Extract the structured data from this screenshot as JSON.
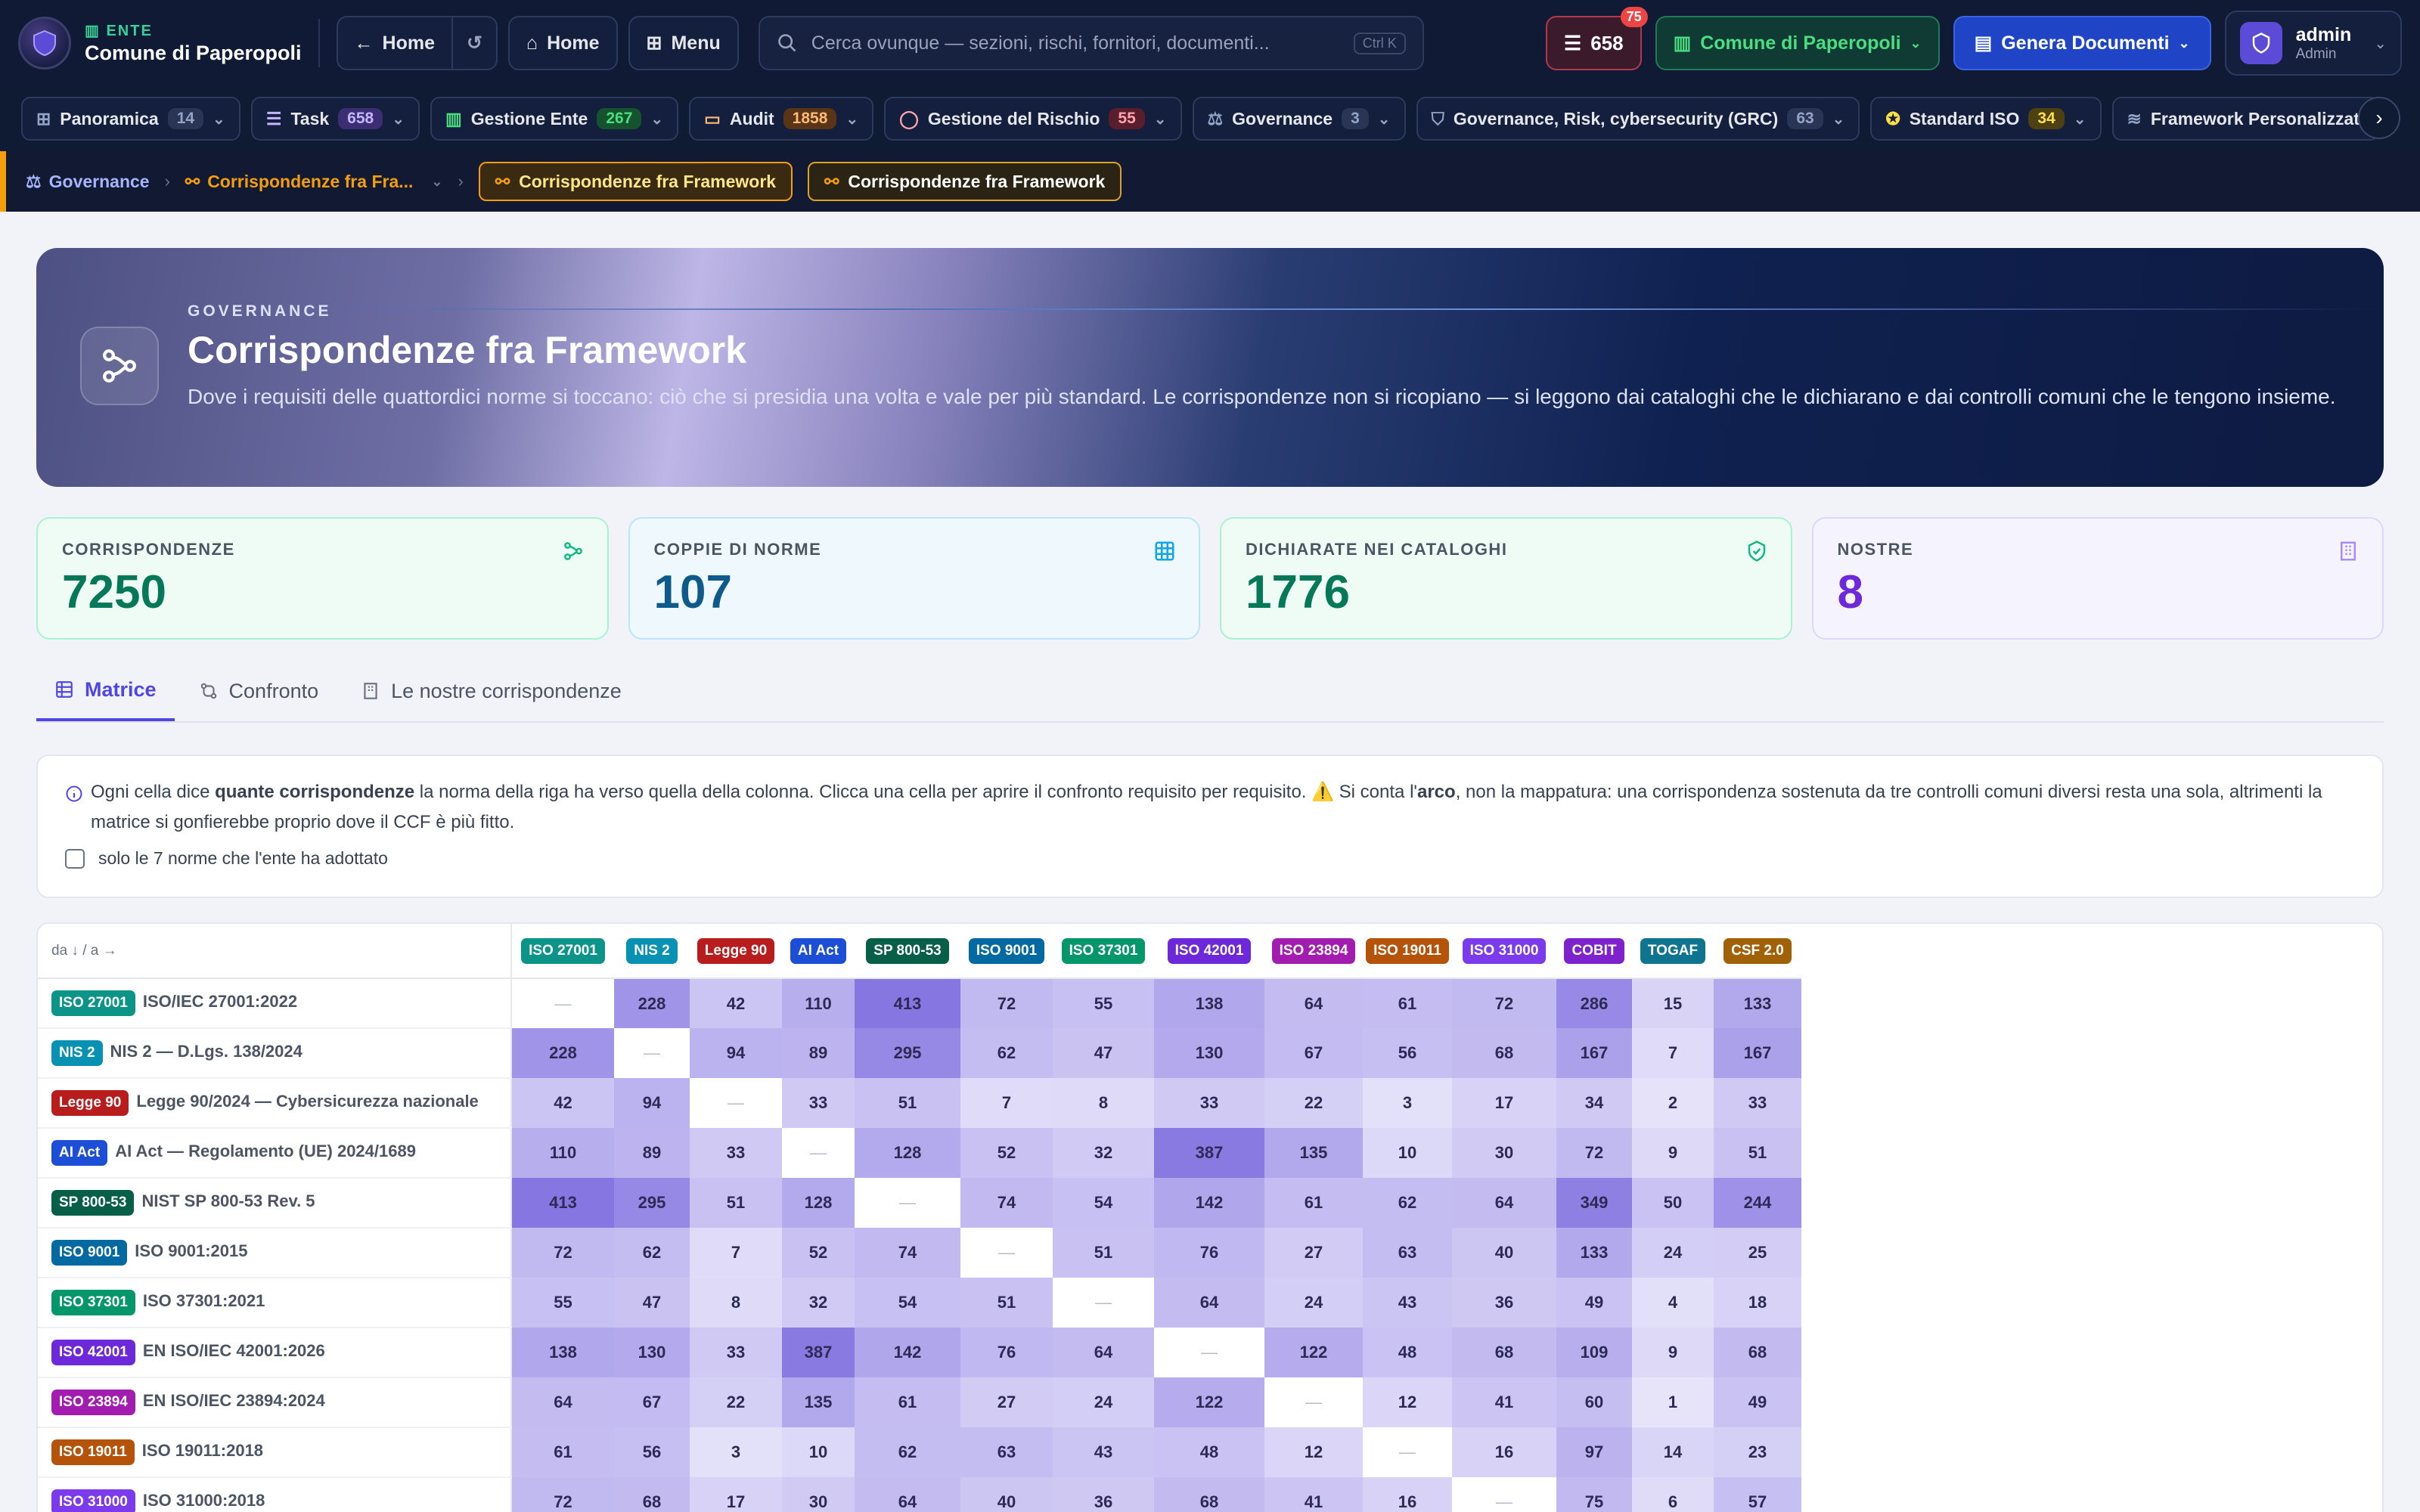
{
  "header": {
    "ente_label": "ENTE",
    "ente_name": "Comune di Paperopoli",
    "home_back_label": "Home",
    "home_label": "Home",
    "menu_label": "Menu",
    "search_placeholder": "Cerca ovunque — sezioni, rischi, fornitori, documenti...",
    "search_shortcut": "Ctrl K",
    "task_count": "658",
    "task_badge": "75",
    "ente_selector": "Comune di Paperopoli",
    "generate_label": "Genera Documenti",
    "user_name": "admin",
    "user_role": "Admin"
  },
  "modules": [
    {
      "label": "Panoramica",
      "count": "14",
      "color": "#93a4c8",
      "bg": "#2a3556"
    },
    {
      "label": "Task",
      "count": "658",
      "color": "#c4b5fd",
      "bg": "#3b2e73"
    },
    {
      "label": "Gestione Ente",
      "count": "267",
      "color": "#4ade80",
      "bg": "#14532d"
    },
    {
      "label": "Audit",
      "count": "1858",
      "color": "#fdba74",
      "bg": "#5a3416"
    },
    {
      "label": "Gestione del Rischio",
      "count": "55",
      "color": "#fda4af",
      "bg": "#5a1d2b"
    },
    {
      "label": "Governance",
      "count": "3",
      "color": "#93a4c8",
      "bg": "#2a3556"
    },
    {
      "label": "Governance, Risk, cybersecurity (GRC)",
      "count": "63",
      "color": "#93a4c8",
      "bg": "#2a3556"
    },
    {
      "label": "Standard ISO",
      "count": "34",
      "color": "#fde047",
      "bg": "#4d4012"
    },
    {
      "label": "Framework Personalizzati",
      "count": "",
      "color": "#93a4c8",
      "bg": "#2a3556"
    }
  ],
  "breadcrumb": {
    "item1": "Governance",
    "item2": "Corrispondenze fra Fra...",
    "chip1": "Corrispondenze fra Framework",
    "chip2": "Corrispondenze fra Framework"
  },
  "hero": {
    "kicker": "GOVERNANCE",
    "title": "Corrispondenze fra Framework",
    "subtitle": "Dove i requisiti delle quattordici norme si toccano: ciò che si presidia una volta e vale per più standard. Le corrispondenze non si ricopiano — si leggono dai cataloghi che le dichiarano e dai controlli comuni che le tengono insieme."
  },
  "stats": [
    {
      "label": "CORRISPONDENZE",
      "value": "7250"
    },
    {
      "label": "COPPIE DI NORME",
      "value": "107"
    },
    {
      "label": "DICHIARATE NEI CATALOGHI",
      "value": "1776"
    },
    {
      "label": "NOSTRE",
      "value": "8"
    }
  ],
  "tabs": [
    {
      "label": "Matrice"
    },
    {
      "label": "Confronto"
    },
    {
      "label": "Le nostre corrispondenze"
    }
  ],
  "info": {
    "t1": "Ogni cella dice ",
    "t2": "quante corrispondenze",
    "t3": " la norma della riga ha verso quella della colonna. Clicca una cella per aprire il confronto requisito per requisito. ⚠️ Si conta l'",
    "t4": "arco",
    "t5": ", non la mappatura: una corrispondenza sostenuta da tre controlli comuni diversi resta una sola, altrimenti la matrice si gonfierebbe proprio dove il CCF è più fitto.",
    "checkbox_label": "solo le 7 norme che l'ente ha adottato"
  },
  "matrix": {
    "corner": "da ↓ / a →",
    "columns": [
      {
        "code": "ISO 27001",
        "color": "#0d9488"
      },
      {
        "code": "NIS 2",
        "color": "#0891b2"
      },
      {
        "code": "Legge 90",
        "color": "#b91c1c"
      },
      {
        "code": "AI Act",
        "color": "#1d4ed8"
      },
      {
        "code": "SP 800-53",
        "color": "#065f46"
      },
      {
        "code": "ISO 9001",
        "color": "#0369a1"
      },
      {
        "code": "ISO 37301",
        "color": "#059669"
      },
      {
        "code": "ISO 42001",
        "color": "#6d28d9"
      },
      {
        "code": "ISO 23894",
        "color": "#a21caf"
      },
      {
        "code": "ISO 19011",
        "color": "#b45309"
      },
      {
        "code": "ISO 31000",
        "color": "#7c3aed"
      },
      {
        "code": "COBIT",
        "color": "#7e22ce"
      },
      {
        "code": "TOGAF",
        "color": "#0e7490"
      },
      {
        "code": "CSF 2.0",
        "color": "#a16207"
      }
    ],
    "rows": [
      {
        "code": "ISO 27001",
        "name": "ISO/IEC 27001:2022",
        "color": "#0d9488",
        "values": [
          null,
          228,
          42,
          110,
          413,
          72,
          55,
          138,
          64,
          61,
          72,
          286,
          15,
          133
        ]
      },
      {
        "code": "NIS 2",
        "name": "NIS 2 — D.Lgs. 138/2024",
        "color": "#0891b2",
        "values": [
          228,
          null,
          94,
          89,
          295,
          62,
          47,
          130,
          67,
          56,
          68,
          167,
          7,
          167
        ]
      },
      {
        "code": "Legge 90",
        "name": "Legge 90/2024 — Cybersicurezza nazionale",
        "color": "#b91c1c",
        "values": [
          42,
          94,
          null,
          33,
          51,
          7,
          8,
          33,
          22,
          3,
          17,
          34,
          2,
          33
        ]
      },
      {
        "code": "AI Act",
        "name": "AI Act — Regolamento (UE) 2024/1689",
        "color": "#1d4ed8",
        "values": [
          110,
          89,
          33,
          null,
          128,
          52,
          32,
          387,
          135,
          10,
          30,
          72,
          9,
          51
        ]
      },
      {
        "code": "SP 800-53",
        "name": "NIST SP 800-53 Rev. 5",
        "color": "#065f46",
        "values": [
          413,
          295,
          51,
          128,
          null,
          74,
          54,
          142,
          61,
          62,
          64,
          349,
          50,
          244
        ]
      },
      {
        "code": "ISO 9001",
        "name": "ISO 9001:2015",
        "color": "#0369a1",
        "values": [
          72,
          62,
          7,
          52,
          74,
          null,
          51,
          76,
          27,
          63,
          40,
          133,
          24,
          25
        ]
      },
      {
        "code": "ISO 37301",
        "name": "ISO 37301:2021",
        "color": "#059669",
        "values": [
          55,
          47,
          8,
          32,
          54,
          51,
          null,
          64,
          24,
          43,
          36,
          49,
          4,
          18
        ]
      },
      {
        "code": "ISO 42001",
        "name": "EN ISO/IEC 42001:2026",
        "color": "#6d28d9",
        "values": [
          138,
          130,
          33,
          387,
          142,
          76,
          64,
          null,
          122,
          48,
          68,
          109,
          9,
          68
        ]
      },
      {
        "code": "ISO 23894",
        "name": "EN ISO/IEC 23894:2024",
        "color": "#a21caf",
        "values": [
          64,
          67,
          22,
          135,
          61,
          27,
          24,
          122,
          null,
          12,
          41,
          60,
          1,
          49
        ]
      },
      {
        "code": "ISO 19011",
        "name": "ISO 19011:2018",
        "color": "#b45309",
        "values": [
          61,
          56,
          3,
          10,
          62,
          63,
          43,
          48,
          12,
          null,
          16,
          97,
          14,
          23
        ]
      },
      {
        "code": "ISO 31000",
        "name": "ISO 31000:2018",
        "color": "#7c3aed",
        "values": [
          72,
          68,
          17,
          30,
          64,
          40,
          36,
          68,
          41,
          16,
          null,
          75,
          6,
          57
        ]
      }
    ]
  }
}
